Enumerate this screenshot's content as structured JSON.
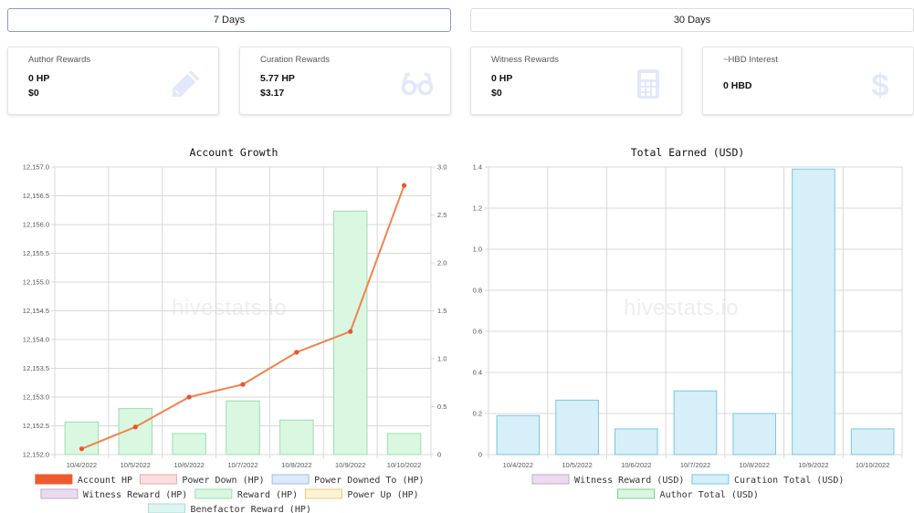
{
  "tabs": [
    {
      "label": "7 Days",
      "active": true
    },
    {
      "label": "30 Days",
      "active": false
    }
  ],
  "cards": [
    {
      "title": "Author Rewards",
      "line1": "0 HP",
      "line2": "$0",
      "icon": "pencil-icon"
    },
    {
      "title": "Curation Rewards",
      "line1": "5.77 HP",
      "line2": "$3.17",
      "icon": "glasses-icon"
    },
    {
      "title": "Witness Rewards",
      "line1": "0 HP",
      "line2": "$0",
      "icon": "calculator-icon"
    },
    {
      "title": "~HBD Interest",
      "line1": "0 HBD",
      "icon": "dollar-icon"
    }
  ],
  "watermark": "hivestats.io",
  "colors": {
    "account_hp": "#f0834d",
    "account_hp_dot": "#e8562a",
    "reward_fill": "#d9f7e1",
    "reward_stroke": "#9fdcb0",
    "curation_fill": "#d6eff9",
    "curation_stroke": "#7cc6dc",
    "grid": "#d8d8d8",
    "card_icon": "#e3e7fb"
  },
  "chart_data": [
    {
      "type": "bar",
      "title": "Account Growth",
      "categories": [
        "10/4/2022",
        "10/5/2022",
        "10/6/2022",
        "10/7/2022",
        "10/8/2022",
        "10/9/2022",
        "10/10/2022"
      ],
      "ylim_left": [
        12152.0,
        12157.0
      ],
      "ylim_right": [
        0,
        3.0
      ],
      "yticks_left": [
        "12,152.0",
        "12,152.5",
        "12,153.0",
        "12,153.5",
        "12,154.0",
        "12,154.5",
        "12,155.0",
        "12,155.5",
        "12,156.0",
        "12,156.5",
        "12,157.0"
      ],
      "yticks_right": [
        "0",
        "0.5",
        "1.0",
        "1.5",
        "2.0",
        "2.5",
        "3.0"
      ],
      "series": [
        {
          "name": "Account HP",
          "kind": "line",
          "axis": "left",
          "values": [
            12152.1,
            12152.48,
            12153.0,
            12153.22,
            12153.78,
            12154.14,
            12156.68
          ]
        },
        {
          "name": "Reward (HP)",
          "kind": "bar",
          "axis": "right",
          "values": [
            0.34,
            0.48,
            0.22,
            0.56,
            0.36,
            2.54,
            0.22
          ]
        }
      ],
      "legend": [
        {
          "name": "Account HP",
          "fill": "#ee5a2e",
          "stroke": "#ee5a2e"
        },
        {
          "name": "Power Down (HP)",
          "fill": "#fde0e0",
          "stroke": "#f0a0a0"
        },
        {
          "name": "Power Downed To (HP)",
          "fill": "#ddeafc",
          "stroke": "#9bbde8"
        },
        {
          "name": "Witness Reward (HP)",
          "fill": "#eadcee",
          "stroke": "#c2a8c9"
        },
        {
          "name": "Reward (HP)",
          "fill": "#d9f7e1",
          "stroke": "#9fdcb0"
        },
        {
          "name": "Power Up (HP)",
          "fill": "#fdf3d4",
          "stroke": "#e3cc84"
        },
        {
          "name": "Benefactor Reward (HP)",
          "fill": "#def5f1",
          "stroke": "#a9dcd2"
        }
      ]
    },
    {
      "type": "bar",
      "title": "Total Earned (USD)",
      "categories": [
        "10/4/2022",
        "10/5/2022",
        "10/6/2022",
        "10/7/2022",
        "10/8/2022",
        "10/9/2022",
        "10/10/2022"
      ],
      "ylim": [
        0,
        1.4
      ],
      "yticks": [
        "0",
        "0.2",
        "0.4",
        "0.6",
        "0.8",
        "1.0",
        "1.2",
        "1.4"
      ],
      "series": [
        {
          "name": "Curation Total (USD)",
          "values": [
            0.19,
            0.265,
            0.125,
            0.31,
            0.2,
            1.39,
            0.125
          ]
        }
      ],
      "legend": [
        {
          "name": "Witness Reward (USD)",
          "fill": "#eadcee",
          "stroke": "#c2a8c9"
        },
        {
          "name": "Curation Total (USD)",
          "fill": "#d6eff9",
          "stroke": "#7cc6dc"
        },
        {
          "name": "Author Total (USD)",
          "fill": "#d9f7e1",
          "stroke": "#7fcf92"
        }
      ]
    }
  ]
}
